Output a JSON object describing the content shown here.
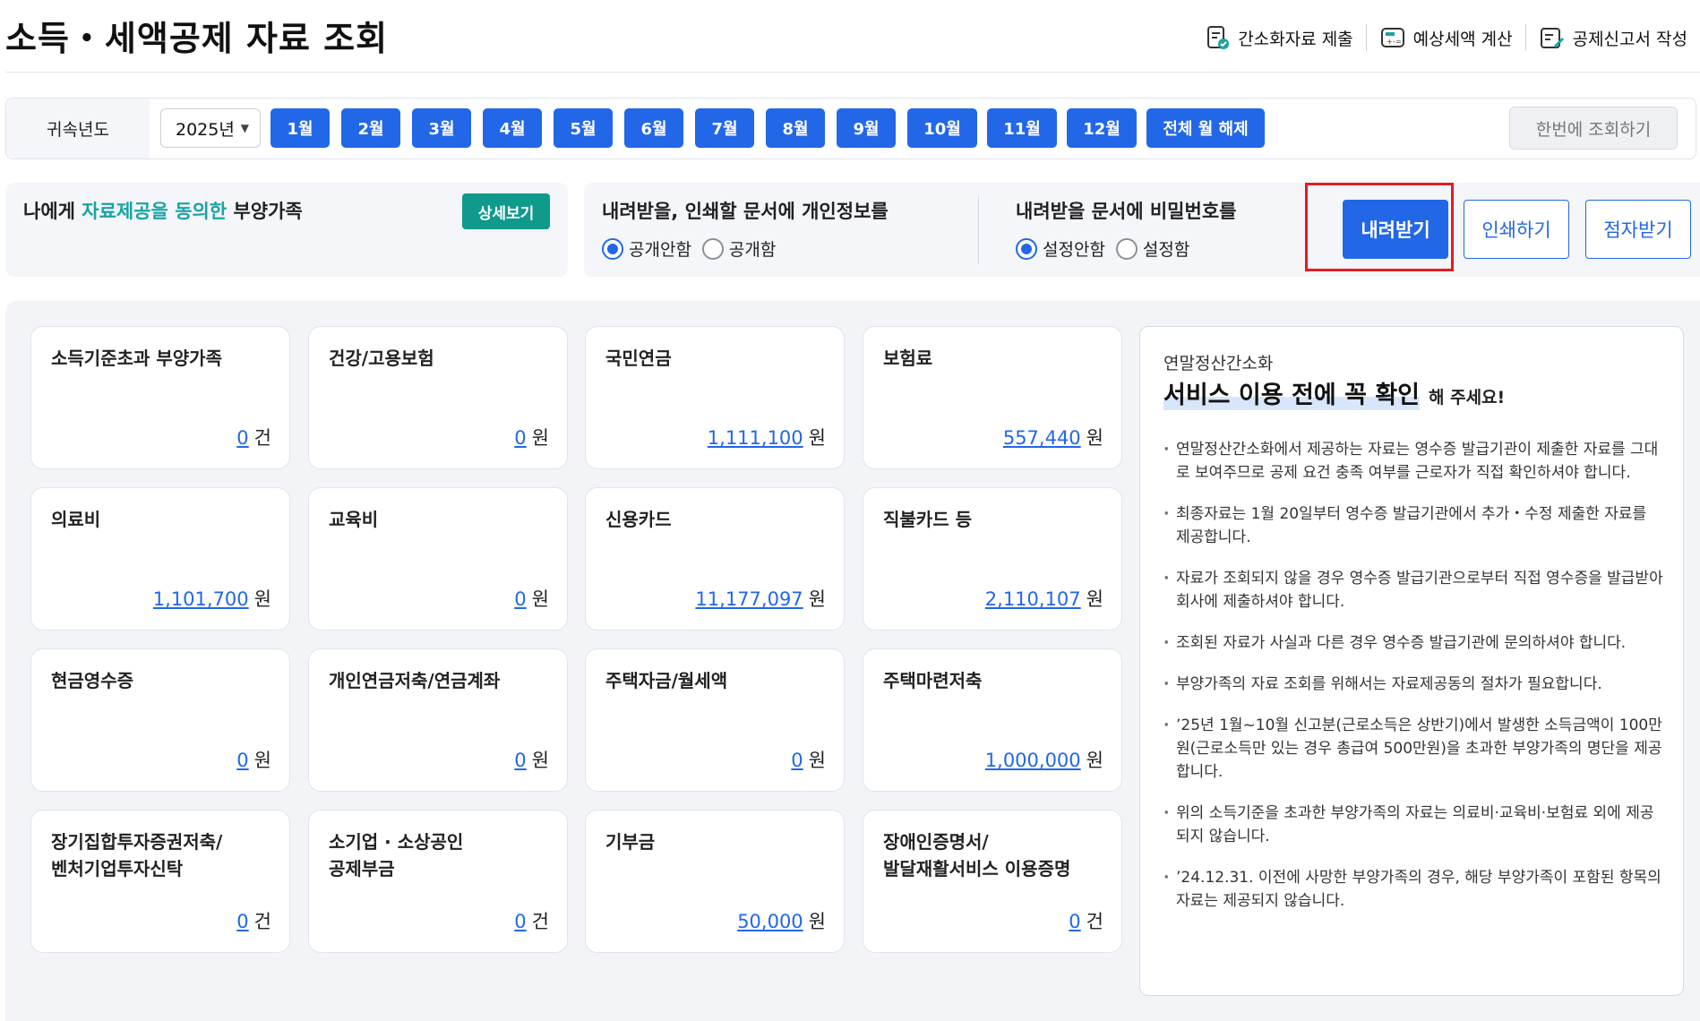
{
  "page_title": "소득・세액공제 자료 조회",
  "top_links": [
    {
      "label": "간소화자료 제출",
      "icon": "document-check-icon"
    },
    {
      "label": "예상세액 계산",
      "icon": "calculator-icon"
    },
    {
      "label": "공제신고서 작성",
      "icon": "pencil-document-icon"
    }
  ],
  "year_bar": {
    "label": "귀속년도",
    "selected_year": "2025년",
    "months": [
      "1월",
      "2월",
      "3월",
      "4월",
      "5월",
      "6월",
      "7월",
      "8월",
      "9월",
      "10월",
      "11월",
      "12월"
    ],
    "clear_all": "전체 월 해제",
    "query_all": "한번에 조회하기"
  },
  "consent": {
    "prefix": "나에게 ",
    "highlight": "자료제공을 동의한",
    "suffix": " 부양가족",
    "detail_button": "상세보기"
  },
  "options": {
    "privacy": {
      "title": "내려받을, 인쇄할 문서에 개인정보를",
      "options": [
        "공개안함",
        "공개함"
      ],
      "selected": 0
    },
    "password": {
      "title": "내려받을 문서에 비밀번호를",
      "options": [
        "설정안함",
        "설정함"
      ],
      "selected": 0
    }
  },
  "actions": {
    "download": "내려받기",
    "print": "인쇄하기",
    "braille": "점자받기"
  },
  "accent_colors": {
    "primary": "#2267e8",
    "teal": "#0f9a8c",
    "highlight_border": "#e31b23"
  },
  "cards": [
    {
      "title": "소득기준초과 부양가족",
      "value": "0",
      "unit": "건"
    },
    {
      "title": "건강/고용보험",
      "value": "0",
      "unit": "원"
    },
    {
      "title": "국민연금",
      "value": "1,111,100",
      "unit": "원"
    },
    {
      "title": "보험료",
      "value": "557,440",
      "unit": "원"
    },
    {
      "title": "의료비",
      "value": "1,101,700",
      "unit": "원"
    },
    {
      "title": "교육비",
      "value": "0",
      "unit": "원"
    },
    {
      "title": "신용카드",
      "value": "11,177,097",
      "unit": "원"
    },
    {
      "title": "직불카드 등",
      "value": "2,110,107",
      "unit": "원"
    },
    {
      "title": "현금영수증",
      "value": "0",
      "unit": "원"
    },
    {
      "title": "개인연금저축/연금계좌",
      "value": "0",
      "unit": "원"
    },
    {
      "title": "주택자금/월세액",
      "value": "0",
      "unit": "원"
    },
    {
      "title": "주택마련저축",
      "value": "1,000,000",
      "unit": "원"
    },
    {
      "title": "장기집합투자증권저축/\n벤처기업투자신탁",
      "value": "0",
      "unit": "건"
    },
    {
      "title": "소기업 · 소상공인\n공제부금",
      "value": "0",
      "unit": "건"
    },
    {
      "title": "기부금",
      "value": "50,000",
      "unit": "원"
    },
    {
      "title": "장애인증명서/\n발달재활서비스 이용증명",
      "value": "0",
      "unit": "건"
    }
  ],
  "info": {
    "sub": "연말정산간소화",
    "head_big": "서비스 이용 전에 꼭 확인",
    "head_small": "해 주세요!",
    "items": [
      "연말정산간소화에서 제공하는 자료는 영수증 발급기관이 제출한 자료를 그대로 보여주므로 공제 요건 충족 여부를 근로자가 직접 확인하셔야 합니다.",
      "최종자료는 1월 20일부터 영수증 발급기관에서 추가・수정 제출한 자료를 제공합니다.",
      "자료가 조회되지 않을 경우 영수증 발급기관으로부터 직접 영수증을 발급받아 회사에 제출하셔야 합니다.",
      "조회된 자료가 사실과 다른 경우 영수증 발급기관에 문의하셔야 합니다.",
      "부양가족의 자료 조회를 위해서는 자료제공동의 절차가 필요합니다.",
      "’25년 1월~10월 신고분(근로소득은 상반기)에서 발생한 소득금액이 100만원(근로소득만 있는 경우 총급여 500만원)을 초과한 부양가족의 명단을 제공합니다.",
      "위의 소득기준을 초과한 부양가족의 자료는 의료비·교육비·보험료 외에 제공되지 않습니다.",
      "’24.12.31. 이전에 사망한 부양가족의 경우, 해당 부양가족이 포함된 항목의 자료는 제공되지 않습니다."
    ]
  }
}
